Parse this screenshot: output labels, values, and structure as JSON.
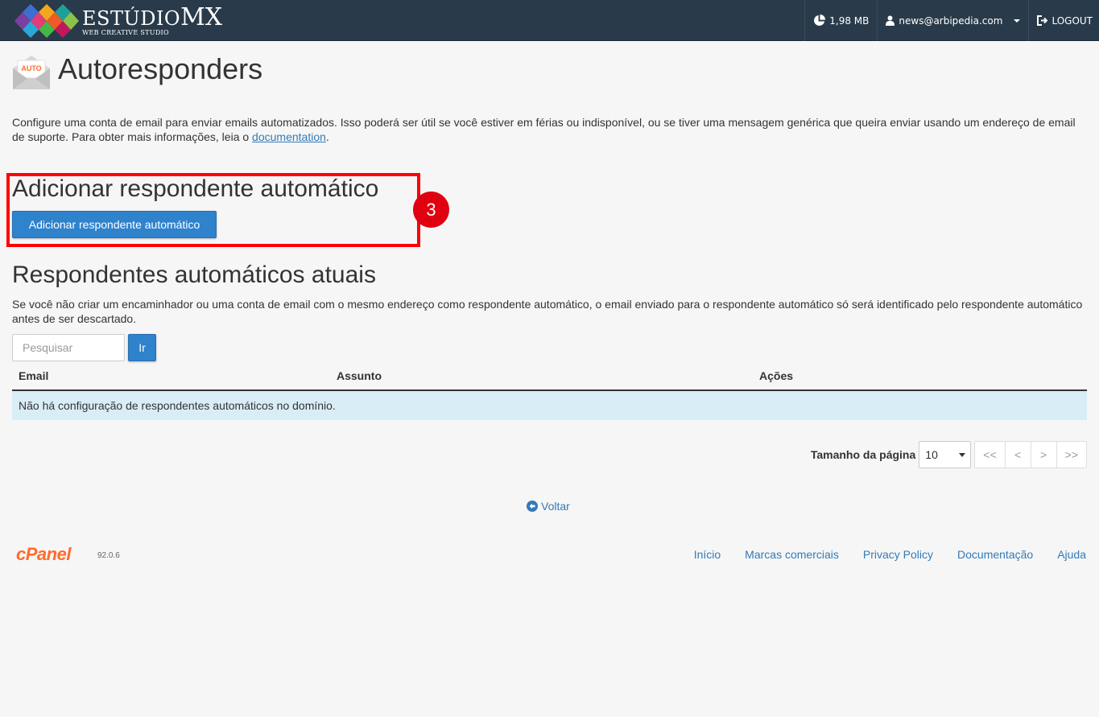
{
  "header": {
    "brand_main": "ESTÚDIO",
    "brand_mx": "MX",
    "brand_sub": "WEB CREATIVE STUDIO",
    "disk_usage": "1,98 MB",
    "user": "news@arbipedia.com",
    "logout": "LOGOUT",
    "icons": [
      "pie-chart-icon",
      "user-icon",
      "logout-icon"
    ]
  },
  "page": {
    "icon_text": "AUTO",
    "title": "Autoresponders",
    "intro_text": "Configure uma conta de email para enviar emails automatizados. Isso poderá ser útil se você estiver em férias ou indisponível, ou se tiver uma mensagem genérica que queira enviar usando um endereço de email de suporte. Para obter mais informações, leia o ",
    "intro_link": "documentation",
    "intro_end": "."
  },
  "add_section": {
    "heading": "Adicionar respondente automático",
    "button": "Adicionar respondente automático",
    "annotation_number": "3"
  },
  "current_section": {
    "heading": "Respondentes automáticos atuais",
    "note": "Se você não criar um encaminhador ou uma conta de email com o mesmo endereço como respondente automático, o email enviado para o respondente automático só será identificado pelo respondente automático antes de ser descartado.",
    "search_placeholder": "Pesquisar",
    "search_button": "Ir"
  },
  "table": {
    "columns": [
      "Email",
      "Assunto",
      "Ações"
    ],
    "empty_message": "Não há configuração de respondentes automáticos no domínio."
  },
  "pager": {
    "label": "Tamanho da página",
    "page_size": "10",
    "buttons": [
      "<<",
      "<",
      ">",
      ">>"
    ]
  },
  "back_link": "Voltar",
  "footer": {
    "logo": "cPanel",
    "version": "92.0.6",
    "links": [
      "Início",
      "Marcas comerciais",
      "Privacy Policy",
      "Documentação",
      "Ajuda"
    ]
  },
  "colors": {
    "topbar": "#293a4a",
    "primary_button": "#2f82cc",
    "link": "#337ab7",
    "highlight": "#ff0000",
    "badge": "#e0000f",
    "empty_row": "#d9edf7",
    "cpanel_orange": "#ff6c2c"
  }
}
